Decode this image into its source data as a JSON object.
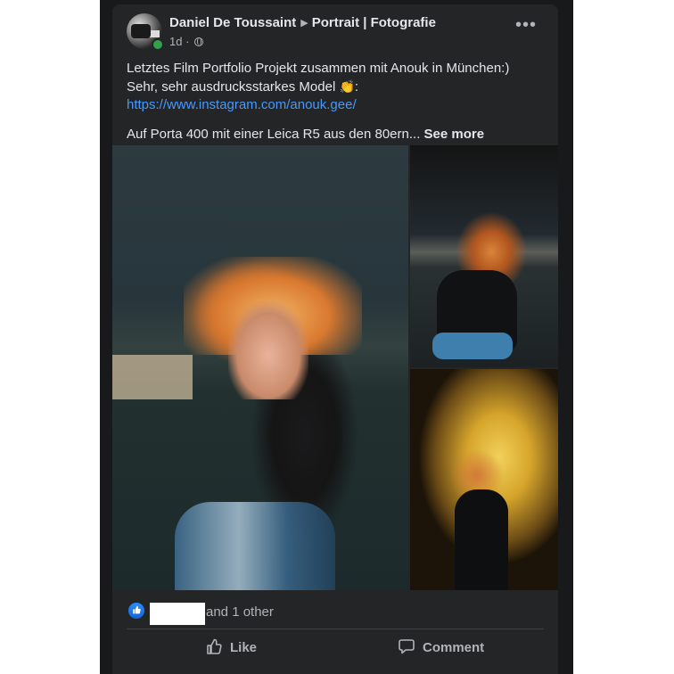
{
  "post": {
    "author": "Daniel De Toussaint",
    "group": "Portrait | Fotografie",
    "time": "1d",
    "time_separator": "·",
    "more_glyph": "•••",
    "text_line_1": "Letztes Film Portfolio Projekt zusammen mit Anouk in München:)",
    "text_line_2": "Sehr, sehr ausdrucksstarkes Model",
    "text_line_2_emoji": "👏",
    "text_line_2_end": ":",
    "link": "https://www.instagram.com/anouk.gee/",
    "text_line_3": "Auf Porta 400 mit einer Leica R5 aus den 80ern...",
    "see_more": "See more"
  },
  "reactions": {
    "icon": "like-icon",
    "summary_suffix": "and 1 other"
  },
  "actions": {
    "like_label": "Like",
    "comment_label": "Comment"
  },
  "icons": {
    "avatar": "profile-avatar",
    "online": "online-status-dot",
    "caret": "right-caret-icon",
    "audience": "globe-icon",
    "more": "more-options-icon",
    "like": "thumbs-up-icon",
    "comment": "comment-bubble-icon"
  },
  "colors": {
    "background": "#18191a",
    "card": "#242526",
    "text_primary": "#e4e6eb",
    "text_secondary": "#b0b3b8",
    "link": "#4599ff",
    "like_blue": "#2c8dfc",
    "online_green": "#31a24c"
  }
}
